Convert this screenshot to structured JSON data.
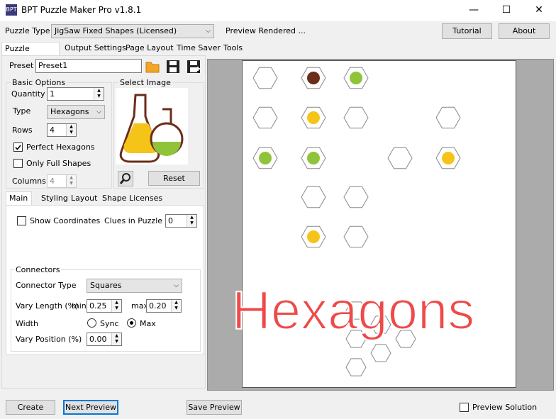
{
  "window": {
    "title": "BPT Puzzle Maker Pro v1.8.1",
    "icon_text": "BPT",
    "minimize": "—",
    "maximize": "☐",
    "close": "✕"
  },
  "top": {
    "puzzle_type_label": "Puzzle Type",
    "puzzle_type_value": "JigSaw Fixed Shapes (Licensed)",
    "status": "Preview Rendered ...",
    "tutorial": "Tutorial",
    "about": "About"
  },
  "tabs": [
    "Puzzle Settings",
    "Output Settings",
    "Page Layout",
    "Time Saver",
    "Tools"
  ],
  "preset": {
    "label": "Preset",
    "value": "Preset1"
  },
  "basic": {
    "title": "Basic Options",
    "quantity_label": "Quantity",
    "quantity": "1",
    "type_label": "Type",
    "type": "Hexagons",
    "rows_label": "Rows",
    "rows": "4",
    "perfect_hex": "Perfect Hexagons",
    "only_full": "Only Full Shapes",
    "columns_label": "Columns",
    "columns": "4"
  },
  "image": {
    "title": "Select Image",
    "reset": "Reset"
  },
  "subtabs": [
    "Main",
    "Styling",
    "Layout",
    "Shape Licenses"
  ],
  "main": {
    "show_coords": "Show Coordinates",
    "clues_label": "Clues in Puzzle",
    "clues": "0",
    "connectors_title": "Connectors",
    "connector_type_label": "Connector Type",
    "connector_type": "Squares",
    "vary_length_label": "Vary Length (%)",
    "min_label": "min",
    "min": "0.25",
    "max_label": "max",
    "max": "0.20",
    "width_label": "Width",
    "sync": "Sync",
    "max_radio": "Max",
    "vary_pos_label": "Vary Position (%)",
    "vary_pos": "0.00"
  },
  "bottom": {
    "create": "Create",
    "next_preview": "Next Preview",
    "save_preview": "Save Preview",
    "preview_solution": "Preview Solution"
  },
  "overlay": {
    "text": "Hexagons"
  },
  "colors": {
    "accent": "#0078d7",
    "overlay": "#ee4a4a"
  }
}
